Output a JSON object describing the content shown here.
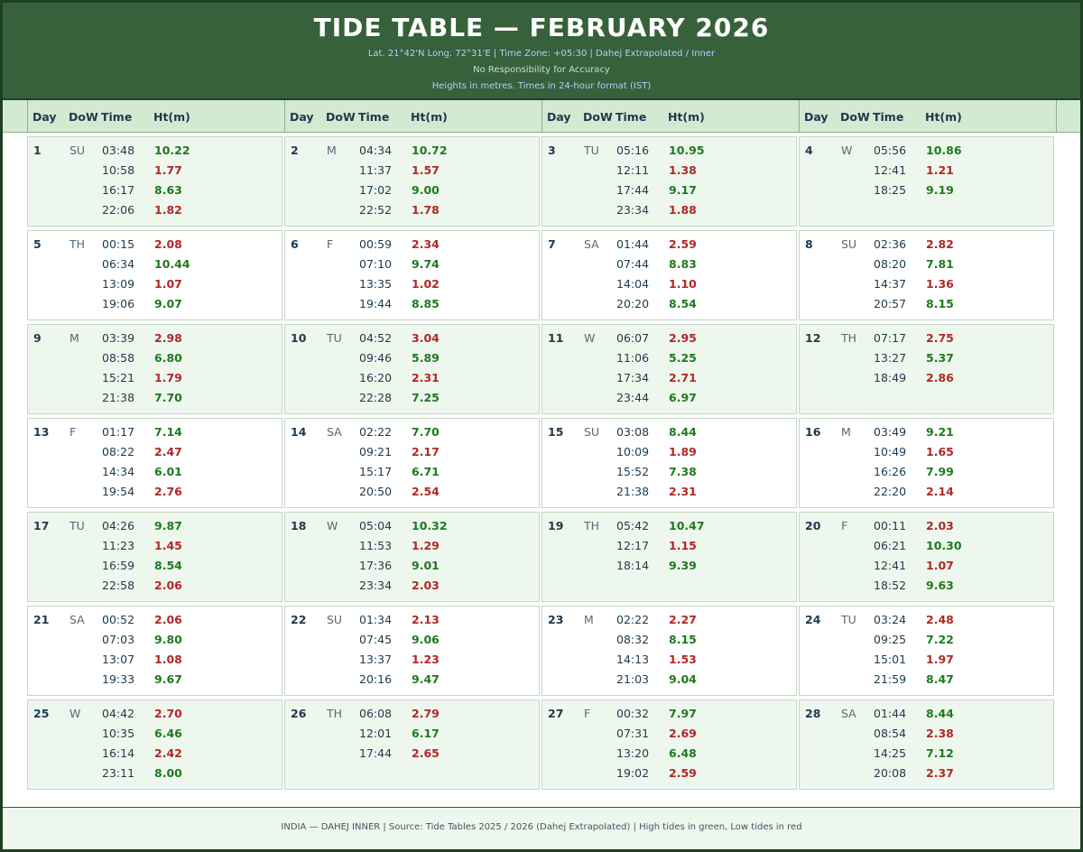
{
  "header": {
    "title": "TIDE TABLE — FEBRUARY 2026",
    "line1": "Lat. 21°42'N  Long. 72°31'E   |   Time Zone: +05:30   |   Dahej Extrapolated / Inner",
    "line2": "No Responsibility for Accuracy",
    "line3": "Heights in metres.  Times in 24-hour format (IST)"
  },
  "columns": {
    "day": "Day",
    "dow": "DoW",
    "time": "Time",
    "height": "Ht(m)"
  },
  "colors": {
    "high": "#1e7a1e",
    "low": "#b02828",
    "header_bg": "#37613a"
  },
  "days": [
    {
      "day": "1",
      "dow": "SU",
      "tides": [
        [
          "03:48",
          "10.22",
          "H"
        ],
        [
          "10:58",
          "1.77",
          "L"
        ],
        [
          "16:17",
          "8.63",
          "H"
        ],
        [
          "22:06",
          "1.82",
          "L"
        ]
      ]
    },
    {
      "day": "2",
      "dow": "M",
      "tides": [
        [
          "04:34",
          "10.72",
          "H"
        ],
        [
          "11:37",
          "1.57",
          "L"
        ],
        [
          "17:02",
          "9.00",
          "H"
        ],
        [
          "22:52",
          "1.78",
          "L"
        ]
      ]
    },
    {
      "day": "3",
      "dow": "TU",
      "tides": [
        [
          "05:16",
          "10.95",
          "H"
        ],
        [
          "12:11",
          "1.38",
          "L"
        ],
        [
          "17:44",
          "9.17",
          "H"
        ],
        [
          "23:34",
          "1.88",
          "L"
        ]
      ]
    },
    {
      "day": "4",
      "dow": "W",
      "tides": [
        [
          "05:56",
          "10.86",
          "H"
        ],
        [
          "12:41",
          "1.21",
          "L"
        ],
        [
          "18:25",
          "9.19",
          "H"
        ]
      ]
    },
    {
      "day": "5",
      "dow": "TH",
      "tides": [
        [
          "00:15",
          "2.08",
          "L"
        ],
        [
          "06:34",
          "10.44",
          "H"
        ],
        [
          "13:09",
          "1.07",
          "L"
        ],
        [
          "19:06",
          "9.07",
          "H"
        ]
      ]
    },
    {
      "day": "6",
      "dow": "F",
      "tides": [
        [
          "00:59",
          "2.34",
          "L"
        ],
        [
          "07:10",
          "9.74",
          "H"
        ],
        [
          "13:35",
          "1.02",
          "L"
        ],
        [
          "19:44",
          "8.85",
          "H"
        ]
      ]
    },
    {
      "day": "7",
      "dow": "SA",
      "tides": [
        [
          "01:44",
          "2.59",
          "L"
        ],
        [
          "07:44",
          "8.83",
          "H"
        ],
        [
          "14:04",
          "1.10",
          "L"
        ],
        [
          "20:20",
          "8.54",
          "H"
        ]
      ]
    },
    {
      "day": "8",
      "dow": "SU",
      "tides": [
        [
          "02:36",
          "2.82",
          "L"
        ],
        [
          "08:20",
          "7.81",
          "H"
        ],
        [
          "14:37",
          "1.36",
          "L"
        ],
        [
          "20:57",
          "8.15",
          "H"
        ]
      ]
    },
    {
      "day": "9",
      "dow": "M",
      "tides": [
        [
          "03:39",
          "2.98",
          "L"
        ],
        [
          "08:58",
          "6.80",
          "H"
        ],
        [
          "15:21",
          "1.79",
          "L"
        ],
        [
          "21:38",
          "7.70",
          "H"
        ]
      ]
    },
    {
      "day": "10",
      "dow": "TU",
      "tides": [
        [
          "04:52",
          "3.04",
          "L"
        ],
        [
          "09:46",
          "5.89",
          "H"
        ],
        [
          "16:20",
          "2.31",
          "L"
        ],
        [
          "22:28",
          "7.25",
          "H"
        ]
      ]
    },
    {
      "day": "11",
      "dow": "W",
      "tides": [
        [
          "06:07",
          "2.95",
          "L"
        ],
        [
          "11:06",
          "5.25",
          "H"
        ],
        [
          "17:34",
          "2.71",
          "L"
        ],
        [
          "23:44",
          "6.97",
          "H"
        ]
      ]
    },
    {
      "day": "12",
      "dow": "TH",
      "tides": [
        [
          "07:17",
          "2.75",
          "L"
        ],
        [
          "13:27",
          "5.37",
          "H"
        ],
        [
          "18:49",
          "2.86",
          "L"
        ]
      ]
    },
    {
      "day": "13",
      "dow": "F",
      "tides": [
        [
          "01:17",
          "7.14",
          "H"
        ],
        [
          "08:22",
          "2.47",
          "L"
        ],
        [
          "14:34",
          "6.01",
          "H"
        ],
        [
          "19:54",
          "2.76",
          "L"
        ]
      ]
    },
    {
      "day": "14",
      "dow": "SA",
      "tides": [
        [
          "02:22",
          "7.70",
          "H"
        ],
        [
          "09:21",
          "2.17",
          "L"
        ],
        [
          "15:17",
          "6.71",
          "H"
        ],
        [
          "20:50",
          "2.54",
          "L"
        ]
      ]
    },
    {
      "day": "15",
      "dow": "SU",
      "tides": [
        [
          "03:08",
          "8.44",
          "H"
        ],
        [
          "10:09",
          "1.89",
          "L"
        ],
        [
          "15:52",
          "7.38",
          "H"
        ],
        [
          "21:38",
          "2.31",
          "L"
        ]
      ]
    },
    {
      "day": "16",
      "dow": "M",
      "tides": [
        [
          "03:49",
          "9.21",
          "H"
        ],
        [
          "10:49",
          "1.65",
          "L"
        ],
        [
          "16:26",
          "7.99",
          "H"
        ],
        [
          "22:20",
          "2.14",
          "L"
        ]
      ]
    },
    {
      "day": "17",
      "dow": "TU",
      "tides": [
        [
          "04:26",
          "9.87",
          "H"
        ],
        [
          "11:23",
          "1.45",
          "L"
        ],
        [
          "16:59",
          "8.54",
          "H"
        ],
        [
          "22:58",
          "2.06",
          "L"
        ]
      ]
    },
    {
      "day": "18",
      "dow": "W",
      "tides": [
        [
          "05:04",
          "10.32",
          "H"
        ],
        [
          "11:53",
          "1.29",
          "L"
        ],
        [
          "17:36",
          "9.01",
          "H"
        ],
        [
          "23:34",
          "2.03",
          "L"
        ]
      ]
    },
    {
      "day": "19",
      "dow": "TH",
      "tides": [
        [
          "05:42",
          "10.47",
          "H"
        ],
        [
          "12:17",
          "1.15",
          "L"
        ],
        [
          "18:14",
          "9.39",
          "H"
        ]
      ]
    },
    {
      "day": "20",
      "dow": "F",
      "tides": [
        [
          "00:11",
          "2.03",
          "L"
        ],
        [
          "06:21",
          "10.30",
          "H"
        ],
        [
          "12:41",
          "1.07",
          "L"
        ],
        [
          "18:52",
          "9.63",
          "H"
        ]
      ]
    },
    {
      "day": "21",
      "dow": "SA",
      "tides": [
        [
          "00:52",
          "2.06",
          "L"
        ],
        [
          "07:03",
          "9.80",
          "H"
        ],
        [
          "13:07",
          "1.08",
          "L"
        ],
        [
          "19:33",
          "9.67",
          "H"
        ]
      ]
    },
    {
      "day": "22",
      "dow": "SU",
      "tides": [
        [
          "01:34",
          "2.13",
          "L"
        ],
        [
          "07:45",
          "9.06",
          "H"
        ],
        [
          "13:37",
          "1.23",
          "L"
        ],
        [
          "20:16",
          "9.47",
          "H"
        ]
      ]
    },
    {
      "day": "23",
      "dow": "M",
      "tides": [
        [
          "02:22",
          "2.27",
          "L"
        ],
        [
          "08:32",
          "8.15",
          "H"
        ],
        [
          "14:13",
          "1.53",
          "L"
        ],
        [
          "21:03",
          "9.04",
          "H"
        ]
      ]
    },
    {
      "day": "24",
      "dow": "TU",
      "tides": [
        [
          "03:24",
          "2.48",
          "L"
        ],
        [
          "09:25",
          "7.22",
          "H"
        ],
        [
          "15:01",
          "1.97",
          "L"
        ],
        [
          "21:59",
          "8.47",
          "H"
        ]
      ]
    },
    {
      "day": "25",
      "dow": "W",
      "tides": [
        [
          "04:42",
          "2.70",
          "L"
        ],
        [
          "10:35",
          "6.46",
          "H"
        ],
        [
          "16:14",
          "2.42",
          "L"
        ],
        [
          "23:11",
          "8.00",
          "H"
        ]
      ]
    },
    {
      "day": "26",
      "dow": "TH",
      "tides": [
        [
          "06:08",
          "2.79",
          "L"
        ],
        [
          "12:01",
          "6.17",
          "H"
        ],
        [
          "17:44",
          "2.65",
          "L"
        ]
      ]
    },
    {
      "day": "27",
      "dow": "F",
      "tides": [
        [
          "00:32",
          "7.97",
          "H"
        ],
        [
          "07:31",
          "2.69",
          "L"
        ],
        [
          "13:20",
          "6.48",
          "H"
        ],
        [
          "19:02",
          "2.59",
          "L"
        ]
      ]
    },
    {
      "day": "28",
      "dow": "SA",
      "tides": [
        [
          "01:44",
          "8.44",
          "H"
        ],
        [
          "08:54",
          "2.38",
          "L"
        ],
        [
          "14:25",
          "7.12",
          "H"
        ],
        [
          "20:08",
          "2.37",
          "L"
        ]
      ]
    }
  ],
  "footer": "INDIA — DAHEJ INNER   |   Source: Tide Tables 2025 / 2026 (Dahej Extrapolated)   |   High tides in green, Low tides in red"
}
